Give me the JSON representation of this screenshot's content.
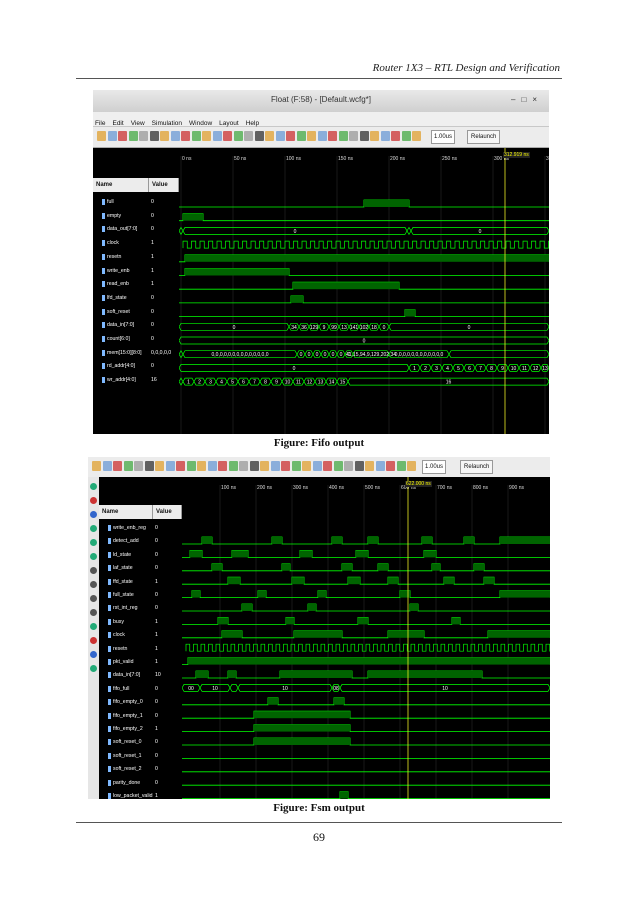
{
  "header": {
    "title": "Router 1X3 – RTL Design and Verification"
  },
  "figure1": {
    "window_title": "Float (F:58) - [Default.wcfg*]",
    "menu": [
      "File",
      "Edit",
      "View",
      "Simulation",
      "Window",
      "Layout",
      "Help"
    ],
    "time_unit": "1.00us",
    "relaunch": "Relaunch",
    "cursor_time": "312.919 ns",
    "col_name": "Name",
    "col_value": "Value",
    "ticks": [
      "0 ns",
      "50 ns",
      "100 ns",
      "150 ns",
      "200 ns",
      "250 ns",
      "300 ns",
      "350"
    ],
    "signals": [
      {
        "name": "full",
        "value": "0"
      },
      {
        "name": "empty",
        "value": "0"
      },
      {
        "name": "data_out[7:0]",
        "value": "0"
      },
      {
        "name": "clock",
        "value": "1"
      },
      {
        "name": "resetn",
        "value": "1"
      },
      {
        "name": "write_enb",
        "value": "1"
      },
      {
        "name": "read_enb",
        "value": "1"
      },
      {
        "name": "lfd_state",
        "value": "0"
      },
      {
        "name": "soft_reset",
        "value": "0"
      },
      {
        "name": "data_in[7:0]",
        "value": "0"
      },
      {
        "name": "count[6:0]",
        "value": "0"
      },
      {
        "name": "mem[15:0][8:0]",
        "value": "0,0,0,0,0"
      },
      {
        "name": "rd_addr[4:0]",
        "value": "0"
      },
      {
        "name": "wr_addr[4:0]",
        "value": "16"
      }
    ],
    "bus_labels": {
      "data_out": [
        "0",
        "0",
        "X",
        "0"
      ],
      "data_in": [
        "0",
        "34",
        "36",
        "129",
        "9",
        "99",
        "13",
        "141",
        "102",
        "18",
        "0"
      ],
      "count": [
        "0"
      ],
      "mem": [
        "0,0,0,0,0,0,0,0,0,0,0,0,0,0",
        "41,15,94,9,129,202,34",
        "0,0,0,0,0,0,0,0,0,0,0,0"
      ],
      "rd_addr": [
        "0",
        "1",
        "2",
        "3",
        "4",
        "5",
        "6",
        "7",
        "8",
        "9",
        "10",
        "11",
        "12"
      ],
      "wr_addr": [
        "0",
        "1",
        "2",
        "3",
        "4",
        "5",
        "6",
        "7",
        "8",
        "9",
        "10",
        "11",
        "12",
        "13",
        "14",
        "15",
        "16"
      ]
    },
    "caption": "Figure: Fifo output"
  },
  "figure2": {
    "time_unit": "1.00us",
    "relaunch": "Relaunch",
    "cursor_time": "622.000 ns",
    "col_name": "Name",
    "col_value": "Value",
    "ticks": [
      "100 ns",
      "200 ns",
      "300 ns",
      "400 ns",
      "500 ns",
      "600 ns",
      "700 ns",
      "800 ns",
      "900 ns"
    ],
    "signals": [
      {
        "name": "write_enb_reg",
        "value": "0"
      },
      {
        "name": "detect_add",
        "value": "0"
      },
      {
        "name": "ld_state",
        "value": "0"
      },
      {
        "name": "laf_state",
        "value": "0"
      },
      {
        "name": "ffd_state",
        "value": "1"
      },
      {
        "name": "full_state",
        "value": "0"
      },
      {
        "name": "rst_int_reg",
        "value": "0"
      },
      {
        "name": "busy",
        "value": "1"
      },
      {
        "name": "clock",
        "value": "1"
      },
      {
        "name": "resetn",
        "value": "1"
      },
      {
        "name": "pkt_valid",
        "value": "1"
      },
      {
        "name": "data_in[7:0]",
        "value": "10"
      },
      {
        "name": "fifo_full",
        "value": "0"
      },
      {
        "name": "fifo_empty_0",
        "value": "0"
      },
      {
        "name": "fifo_empty_1",
        "value": "0"
      },
      {
        "name": "fifo_empty_2",
        "value": "1"
      },
      {
        "name": "soft_reset_0",
        "value": "0"
      },
      {
        "name": "soft_reset_1",
        "value": "0"
      },
      {
        "name": "soft_reset_2",
        "value": "0"
      },
      {
        "name": "parity_done",
        "value": "0"
      },
      {
        "name": "low_packet_valid",
        "value": "1"
      }
    ],
    "bus_labels": {
      "data_in": [
        "00",
        "10",
        "10",
        "08",
        "10"
      ]
    },
    "caption": "Figure: Fsm output"
  },
  "page_number": "69"
}
